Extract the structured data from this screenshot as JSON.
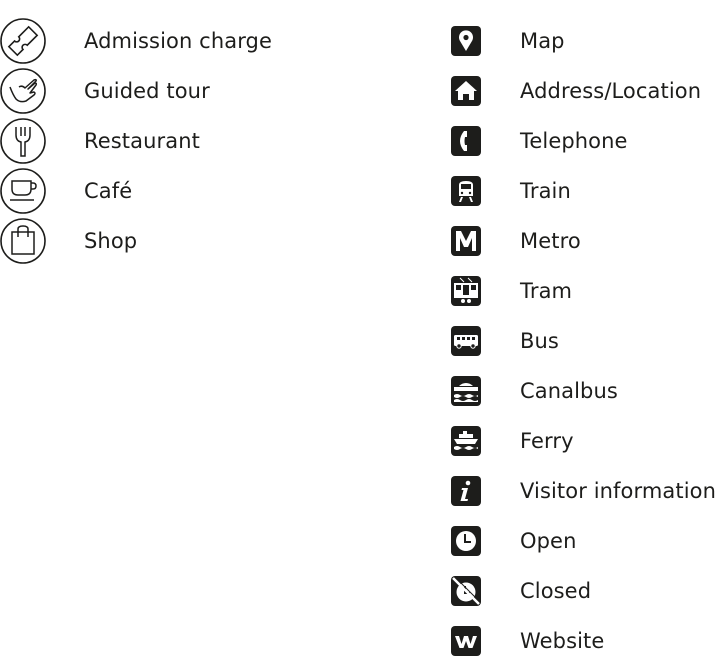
{
  "colors": {
    "ink": "#1d1d1b",
    "background": "#ffffff"
  },
  "left_legend": [
    {
      "icon": "ticket-icon",
      "label": "Admission charge"
    },
    {
      "icon": "pointing-hand-icon",
      "label": "Guided tour"
    },
    {
      "icon": "fork-icon",
      "label": "Restaurant"
    },
    {
      "icon": "coffee-cup-icon",
      "label": "Café"
    },
    {
      "icon": "shopping-bag-icon",
      "label": "Shop"
    }
  ],
  "right_legend": [
    {
      "icon": "map-pin-icon",
      "label": "Map"
    },
    {
      "icon": "house-icon",
      "label": "Address/Location"
    },
    {
      "icon": "telephone-icon",
      "label": "Telephone"
    },
    {
      "icon": "train-icon",
      "label": "Train"
    },
    {
      "icon": "metro-icon",
      "label": "Metro"
    },
    {
      "icon": "tram-icon",
      "label": "Tram"
    },
    {
      "icon": "bus-icon",
      "label": "Bus"
    },
    {
      "icon": "canalbus-icon",
      "label": "Canalbus"
    },
    {
      "icon": "ferry-icon",
      "label": "Ferry"
    },
    {
      "icon": "info-icon",
      "label": "Visitor information"
    },
    {
      "icon": "clock-icon",
      "label": "Open"
    },
    {
      "icon": "clock-crossed-icon",
      "label": "Closed"
    },
    {
      "icon": "website-icon",
      "label": "Website"
    }
  ]
}
